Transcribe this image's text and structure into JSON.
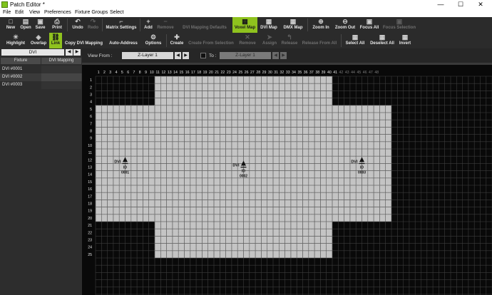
{
  "window": {
    "title": "Patch Editor *",
    "minimize": "—",
    "maximize": "☐",
    "close": "✕"
  },
  "menu": [
    "File",
    "Edit",
    "View",
    "Preferences",
    "Fixture Groups",
    "Select"
  ],
  "toolbar_top": [
    {
      "label": "New",
      "icon": "□"
    },
    {
      "label": "Open",
      "icon": "▤"
    },
    {
      "label": "Save",
      "icon": "▣"
    },
    {
      "label": "Print",
      "icon": "⎙"
    },
    {
      "label": "Undo",
      "icon": "↶"
    },
    {
      "label": "Redo",
      "icon": "↷",
      "disabled": true
    },
    {
      "label": "Matrix Settings",
      "icon": "⌐"
    },
    {
      "label": "Add",
      "icon": "+"
    },
    {
      "label": "Remove",
      "icon": "−",
      "disabled": true
    },
    {
      "label": "DVI Mapping Defaults",
      "icon": "",
      "disabled": true
    },
    {
      "label": "Voxel Map",
      "icon": "▦",
      "active": true
    },
    {
      "label": "DVI Map",
      "icon": "▦"
    },
    {
      "label": "DMX Map",
      "icon": "▦"
    },
    {
      "label": "Zoom In",
      "icon": "⊕"
    },
    {
      "label": "Zoom Out",
      "icon": "⊖"
    },
    {
      "label": "Focus All",
      "icon": "▣"
    },
    {
      "label": "Focus Selection",
      "icon": "▣",
      "disabled": true
    }
  ],
  "toolbar_bottom": [
    {
      "label": "Highlight",
      "icon": "☀"
    },
    {
      "label": "Overlap",
      "icon": "◈"
    },
    {
      "label": "Link",
      "icon": "⛓",
      "active": true
    },
    {
      "label": "Copy DVI Mapping",
      "icon": ""
    },
    {
      "label": "Auto-Address",
      "icon": ""
    },
    {
      "label": "Options",
      "icon": "⚙"
    },
    {
      "label": "Create",
      "icon": "✚"
    },
    {
      "label": "Create From Selection",
      "icon": "",
      "disabled": true
    },
    {
      "label": "Remove",
      "icon": "✕",
      "disabled": true
    },
    {
      "label": "Assign",
      "icon": "➤",
      "disabled": true
    },
    {
      "label": "Release",
      "icon": "↰",
      "disabled": true
    },
    {
      "label": "Release From All",
      "icon": "",
      "disabled": true
    },
    {
      "label": "Select All",
      "icon": "▦"
    },
    {
      "label": "Deselect All",
      "icon": "▦"
    },
    {
      "label": "Invert",
      "icon": "▦"
    }
  ],
  "left_panel": {
    "dvi_selector": "DVI",
    "prev": "◀",
    "next": "▶",
    "columns": [
      "Fixture",
      "DVI Mapping"
    ],
    "fixtures": [
      "DVI #0001",
      "DVI #0002",
      "DVI #0003"
    ]
  },
  "view_bar": {
    "view_from_label": "View From :",
    "view_from_value": "Z-Layer 1",
    "to_label": "To :",
    "to_value": "Z-Layer 1",
    "btn_prev": "◀",
    "btn_next": "▶"
  },
  "grid": {
    "columns": 48,
    "rows": 25,
    "fixtures": [
      {
        "name": "DVI",
        "id_label": "ID",
        "id": "0001",
        "col_start": 1,
        "col_end": 10,
        "row_start": 5,
        "row_end": 20
      },
      {
        "name": "DVI",
        "id_label": "ID",
        "id": "0002",
        "col_start": 11,
        "col_end": 40,
        "row_start": 1,
        "row_end": 25
      },
      {
        "name": "DVI",
        "id_label": "ID",
        "id": "0003",
        "col_start": 41,
        "col_end": 50,
        "row_start": 5,
        "row_end": 20
      }
    ]
  },
  "colors": {
    "accent": "#8fc21e",
    "canvas": "#090909",
    "fixture_fill": "#c4c4c4"
  }
}
